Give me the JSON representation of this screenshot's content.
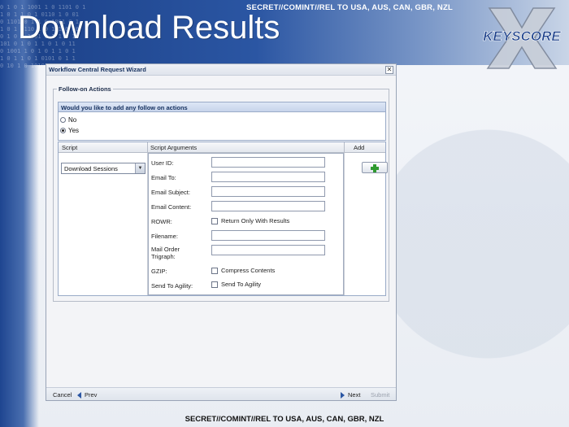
{
  "slide": {
    "title": "Download Results",
    "classification_top": "SECRET//COMINT//REL TO USA, AUS, CAN, GBR, NZL",
    "classification_bottom": "SECRET//COMINT//REL TO USA, AUS, CAN, GBR, NZL",
    "logo_text": "KEYSCORE",
    "binary_bg": "0 1 0 1 1001 1 0 1101 0 1\n1 0 1 1 0 1 0110 1 0 01\n0 1101 0 1 1 0 1001 0 1\n1 0 1 0110 1 0 1 1 0 10\n0 1 0 1 1001 0 1 1 0 1\n101 0 1 0 1 1 0 1 0 11\n0 1001 1 0 1 0 1 1 0 1\n1 0 1 1 0 1 0101 0 1 1\n0 10 1 0 10100 1 0 1 0"
  },
  "wizard": {
    "title": "Workflow Central Request Wizard",
    "close_glyph": "✕",
    "fieldset_legend": "Follow-on Actions",
    "question": "Would you like to add any follow on actions",
    "options": [
      {
        "label": "No",
        "checked": false
      },
      {
        "label": "Yes",
        "checked": true
      }
    ],
    "grid": {
      "columns": [
        "Script",
        "Script Arguments",
        "Add"
      ],
      "script_select_value": "Download Sessions",
      "arguments": [
        {
          "label": "User ID:",
          "type": "text",
          "value": ""
        },
        {
          "label": "Email To:",
          "type": "text",
          "value": ""
        },
        {
          "label": "Email Subject:",
          "type": "text",
          "value": ""
        },
        {
          "label": "Email Content:",
          "type": "text",
          "value": ""
        },
        {
          "label": "ROWR:",
          "type": "checkbox",
          "checkbox_label": "Return Only With Results",
          "checked": false
        },
        {
          "label": "Filename:",
          "type": "text",
          "value": ""
        },
        {
          "label": "Mail Order Trigraph:",
          "type": "text",
          "value": ""
        },
        {
          "label": "GZIP:",
          "type": "checkbox",
          "checkbox_label": "Compress Contents",
          "checked": false
        },
        {
          "label": "Send To Agility:",
          "type": "checkbox",
          "checkbox_label": "Send To Agility",
          "checked": false
        }
      ]
    },
    "footer": {
      "cancel": "Cancel",
      "prev": "Prev",
      "next": "Next",
      "submit": "Submit"
    }
  },
  "colors": {
    "header_blue": "#1a3f86",
    "panel_header": "#c7d4eb",
    "add_icon": "#2f9a2f"
  }
}
